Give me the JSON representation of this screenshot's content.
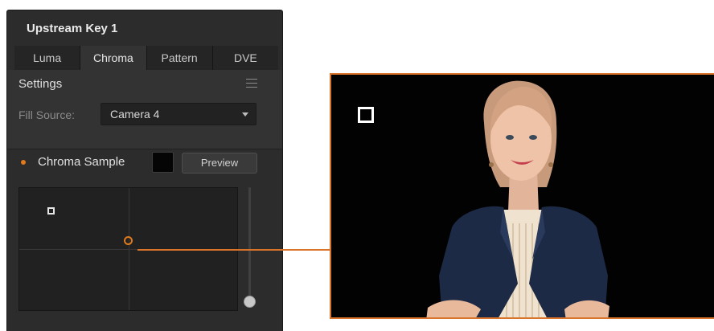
{
  "panel": {
    "title": "Upstream Key 1",
    "tabs": [
      {
        "label": "Luma",
        "active": false
      },
      {
        "label": "Chroma",
        "active": true
      },
      {
        "label": "Pattern",
        "active": false
      },
      {
        "label": "DVE",
        "active": false
      }
    ]
  },
  "settings": {
    "heading": "Settings",
    "menu_icon": "hamburger-menu-icon",
    "fill_source_label": "Fill Source:",
    "fill_source_value": "Camera 4"
  },
  "chroma_sample": {
    "label": "Chroma Sample",
    "swatch_color": "#050505",
    "preview_label": "Preview"
  },
  "colors": {
    "accent": "#e07a1c",
    "panel_bg": "#2c2c2c"
  }
}
